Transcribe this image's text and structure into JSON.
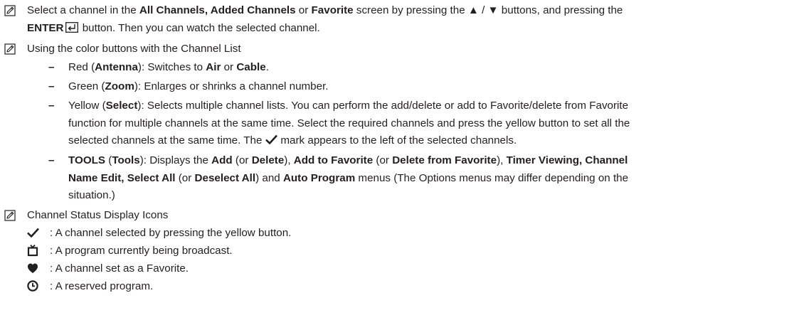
{
  "note1": {
    "icon": "note-icon",
    "line1_pre": "Select a channel in the ",
    "line1_b1": "All Channels, Added Channels",
    "line1_mid": " or ",
    "line1_b2": "Favorite",
    "line1_post": " screen by pressing the ▲ / ▼ buttons, and pressing the",
    "line2_b": "ENTER",
    "enter_icon": "enter-icon",
    "line2_post": " button. Then you can watch the selected channel."
  },
  "note2": {
    "icon": "note-icon",
    "text": "Using the color buttons with the Channel List",
    "items": {
      "red": {
        "dash": "–",
        "pre": "Red (",
        "b1": "Antenna",
        "mid1": "): Switches to ",
        "b2": "Air",
        "mid2": " or ",
        "b3": "Cable",
        "post": "."
      },
      "green": {
        "dash": "–",
        "pre": "Green (",
        "b1": "Zoom",
        "post": "): Enlarges or shrinks a channel number."
      },
      "yellow": {
        "dash": "–",
        "pre": "Yellow (",
        "b1": "Select",
        "post": "): Selects multiple channel lists. You can perform the add/delete or add to Favorite/delete from Favorite",
        "line2": "function for multiple channels at the same time. Select the required channels and press the yellow button to set all the",
        "line3_pre": "selected channels at the same time. The",
        "check_icon": "checkmark-icon",
        "line3_post": "mark appears to the left of the selected channels."
      },
      "tools": {
        "dash": "–",
        "b_tools": "TOOLS",
        "p1": " (",
        "b_tools2": "Tools",
        "p2": "): Displays the ",
        "b_add": "Add",
        "p3": " (or ",
        "b_delete": "Delete",
        "p4": "), ",
        "b_addfav": "Add to Favorite",
        "p5": " (or ",
        "b_delfav": "Delete from Favorite",
        "p6": "), ",
        "b_timer": "Timer Viewing, Channel",
        "l2_b_name": "Name Edit, Select All",
        "l2_p1": " (or ",
        "l2_b_deselect": "Deselect All",
        "l2_p2": ") and ",
        "l2_b_auto": "Auto Program",
        "l2_p3": " menus (The Options menus may differ depending on the",
        "l3": "situation.)"
      }
    }
  },
  "note3": {
    "icon": "note-icon",
    "text": "Channel Status Display Icons",
    "statuses": [
      {
        "icon": "checkmark-icon",
        "text": ": A channel selected by pressing the yellow button."
      },
      {
        "icon": "tv-icon",
        "text": ": A program currently being broadcast."
      },
      {
        "icon": "heart-icon",
        "text": ": A channel set as a Favorite."
      },
      {
        "icon": "clock-icon",
        "text": ": A reserved program."
      }
    ]
  }
}
